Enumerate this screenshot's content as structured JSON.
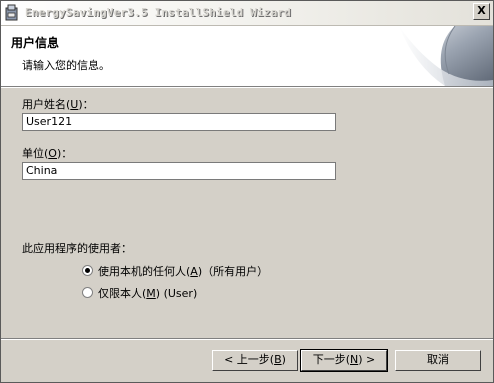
{
  "titlebar": {
    "title": "EnergySavingVer3.5 InstallShield Wizard",
    "close_label": "X"
  },
  "banner": {
    "title": "用户信息",
    "subtitle": "请输入您的信息。"
  },
  "form": {
    "username_label_pre": "用户姓名(",
    "username_label_key": "U",
    "username_label_post": ")：",
    "username_value": "User121",
    "org_label_pre": "单位(",
    "org_label_key": "O",
    "org_label_post": ")：",
    "org_value": "China"
  },
  "users_section": {
    "heading": "此应用程序的使用者：",
    "option_all_pre": "使用本机的任何人(",
    "option_all_key": "A",
    "option_all_post": ")（所有用户）",
    "option_me_pre": "仅限本人(",
    "option_me_key": "M",
    "option_me_post": ") (User)",
    "selected": "all"
  },
  "buttons": {
    "back_pre": "< 上一步(",
    "back_key": "B",
    "back_post": ")",
    "next_pre": "下一步(",
    "next_key": "N",
    "next_post": ") >",
    "cancel": "取消"
  }
}
